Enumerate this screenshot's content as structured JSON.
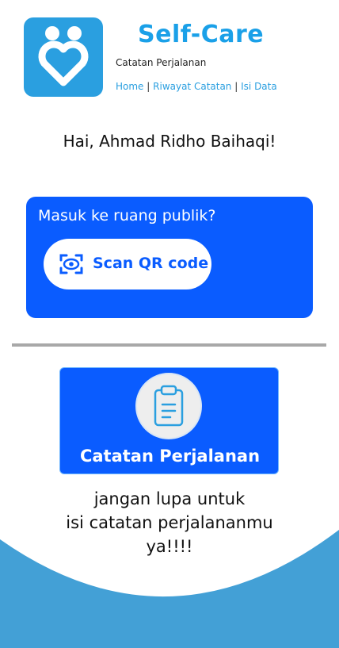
{
  "header": {
    "app_title": "Self-Care",
    "subtitle": "Catatan Perjalanan",
    "nav": {
      "home": "Home",
      "sep1": "|",
      "history": "Riwayat Catatan",
      "sep2": "|",
      "input_data": "Isi Data"
    },
    "logo_icon": "two-people-heart-icon"
  },
  "greeting": "Hai, Ahmad Ridho Baihaqi!",
  "scan_card": {
    "title": "Masuk ke ruang publik?",
    "button_label": "Scan QR code",
    "button_icon": "qr-scan-icon"
  },
  "journal_card": {
    "label": "Catatan Perjalanan",
    "icon": "clipboard-icon"
  },
  "reminder": {
    "line1": "jangan lupa untuk",
    "line2": "isi catatan perjalananmu",
    "line3": "ya!!!!"
  },
  "colors": {
    "primary_blue": "#0a5cff",
    "brand_blue": "#1aa0e8",
    "wave_blue": "#43a0d6",
    "divider_gray": "#a8a8a8"
  }
}
